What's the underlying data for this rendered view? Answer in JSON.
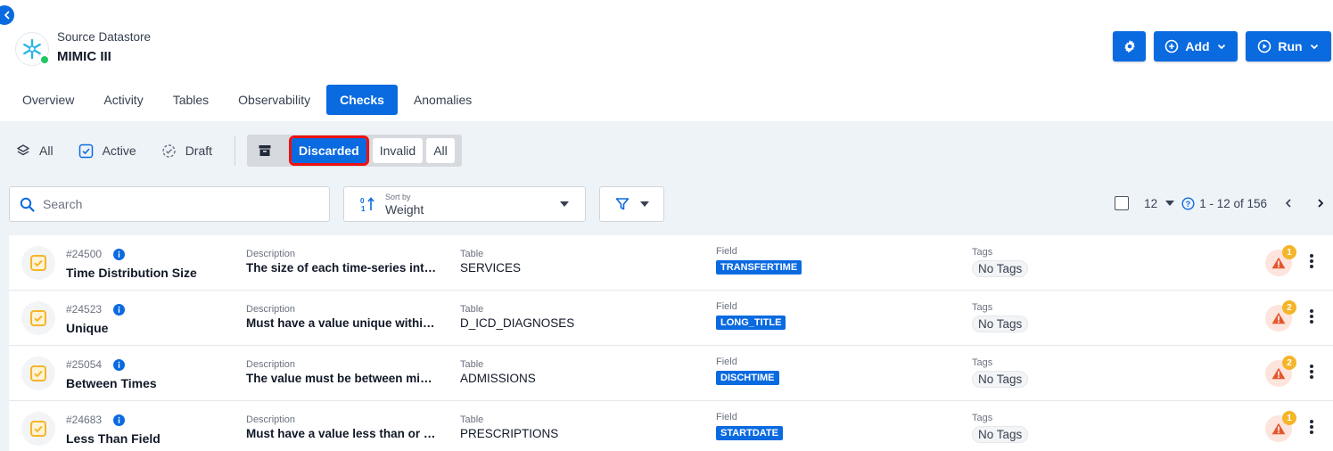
{
  "datastore": {
    "type": "Source Datastore",
    "name": "MIMIC III"
  },
  "actions": {
    "add_label": "Add",
    "run_label": "Run"
  },
  "tabs": [
    {
      "label": "Overview",
      "active": false
    },
    {
      "label": "Activity",
      "active": false
    },
    {
      "label": "Tables",
      "active": false
    },
    {
      "label": "Observability",
      "active": false
    },
    {
      "label": "Checks",
      "active": true
    },
    {
      "label": "Anomalies",
      "active": false
    }
  ],
  "status_filters": {
    "all": "All",
    "active": "Active",
    "draft": "Draft"
  },
  "archived_group": {
    "label": "Archived",
    "discarded": "Discarded",
    "invalid": "Invalid",
    "all": "All"
  },
  "search": {
    "placeholder": "Search"
  },
  "sort": {
    "label": "Sort by",
    "value": "Weight"
  },
  "pagination": {
    "page_size": "12",
    "range": "1 - 12 of 156"
  },
  "checks": [
    {
      "id": "#24500",
      "name": "Time Distribution Size",
      "description_label": "Description",
      "description": "The size of each time-series interval must be",
      "table_label": "Table",
      "table": "SERVICES",
      "field_label": "Field",
      "field": "TRANSFERTIME",
      "tags_label": "Tags",
      "tags": "No Tags",
      "anomaly_count": "1"
    },
    {
      "id": "#24523",
      "name": "Unique",
      "description_label": "Description",
      "description": "Must have a value unique within the table",
      "table_label": "Table",
      "table": "D_ICD_DIAGNOSES",
      "field_label": "Field",
      "field": "LONG_TITLE",
      "tags_label": "Tags",
      "tags": "No Tags",
      "anomaly_count": "2"
    },
    {
      "id": "#25054",
      "name": "Between Times",
      "description_label": "Description",
      "description": "The value must be between minTime and maxTime",
      "table_label": "Table",
      "table": "ADMISSIONS",
      "field_label": "Field",
      "field": "DISCHTIME",
      "tags_label": "Tags",
      "tags": "No Tags",
      "anomaly_count": "2"
    },
    {
      "id": "#24683",
      "name": "Less Than Field",
      "description_label": "Description",
      "description": "Must have a value less than or equal to",
      "table_label": "Table",
      "table": "PRESCRIPTIONS",
      "field_label": "Field",
      "field": "STARTDATE",
      "tags_label": "Tags",
      "tags": "No Tags",
      "anomaly_count": "1"
    }
  ],
  "colors": {
    "primary": "#0a6ae0",
    "highlight": "#e11111",
    "status_ok": "#22c55e",
    "alert": "#e4572e",
    "badge": "#f5b52a"
  }
}
